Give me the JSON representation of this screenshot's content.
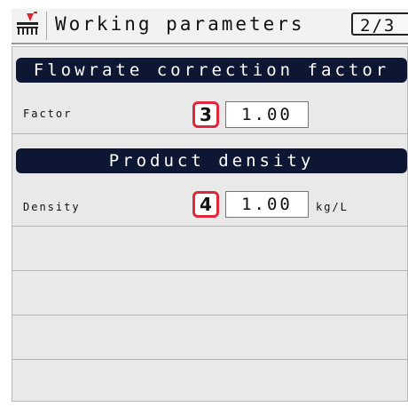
{
  "header": {
    "title": "Working parameters",
    "page_indicator": "2/3",
    "icon": "seeder-icon"
  },
  "sections": [
    {
      "title": "Flowrate correction factor",
      "field": {
        "label": "Factor",
        "badge": "3",
        "value": "1.00",
        "unit": ""
      }
    },
    {
      "title": "Product density",
      "field": {
        "label": "Density",
        "badge": "4",
        "value": "1.00",
        "unit": "kg/L"
      }
    }
  ],
  "colors": {
    "section_header_bg": "#0d1633",
    "badge_border": "#e0283c",
    "icon_accent": "#d9262e"
  }
}
